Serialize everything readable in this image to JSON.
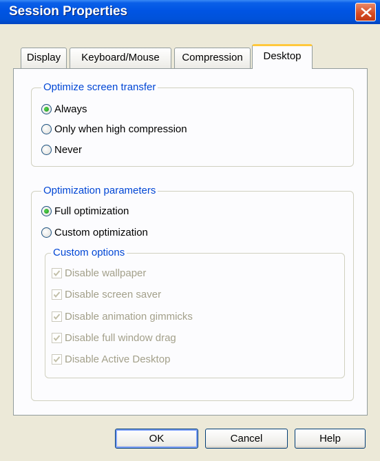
{
  "window": {
    "title": "Session Properties"
  },
  "tabs": [
    {
      "label": "Display"
    },
    {
      "label": "Keyboard/Mouse"
    },
    {
      "label": "Compression"
    },
    {
      "label": "Desktop"
    }
  ],
  "active_tab": "Desktop",
  "optimize_screen_transfer": {
    "label": "Optimize screen transfer",
    "options": [
      {
        "label": "Always",
        "selected": true
      },
      {
        "label": "Only when high compression",
        "selected": false
      },
      {
        "label": "Never",
        "selected": false
      }
    ]
  },
  "optimization_parameters": {
    "label": "Optimization parameters",
    "options": [
      {
        "label": "Full optimization",
        "selected": true
      },
      {
        "label": "Custom optimization",
        "selected": false
      }
    ],
    "custom_options": {
      "label": "Custom options",
      "items": [
        {
          "label": "Disable wallpaper",
          "checked": true,
          "enabled": false
        },
        {
          "label": "Disable screen saver",
          "checked": true,
          "enabled": false
        },
        {
          "label": "Disable animation gimmicks",
          "checked": true,
          "enabled": false
        },
        {
          "label": "Disable full window drag",
          "checked": true,
          "enabled": false
        },
        {
          "label": "Disable Active Desktop",
          "checked": true,
          "enabled": false
        }
      ]
    }
  },
  "buttons": {
    "ok": "OK",
    "cancel": "Cancel",
    "help": "Help"
  },
  "colors": {
    "titlebar": "#0054e3",
    "group_label": "#0046d5",
    "active_tab_accent": "#ffc83c",
    "disabled_text": "#a3a08a"
  }
}
